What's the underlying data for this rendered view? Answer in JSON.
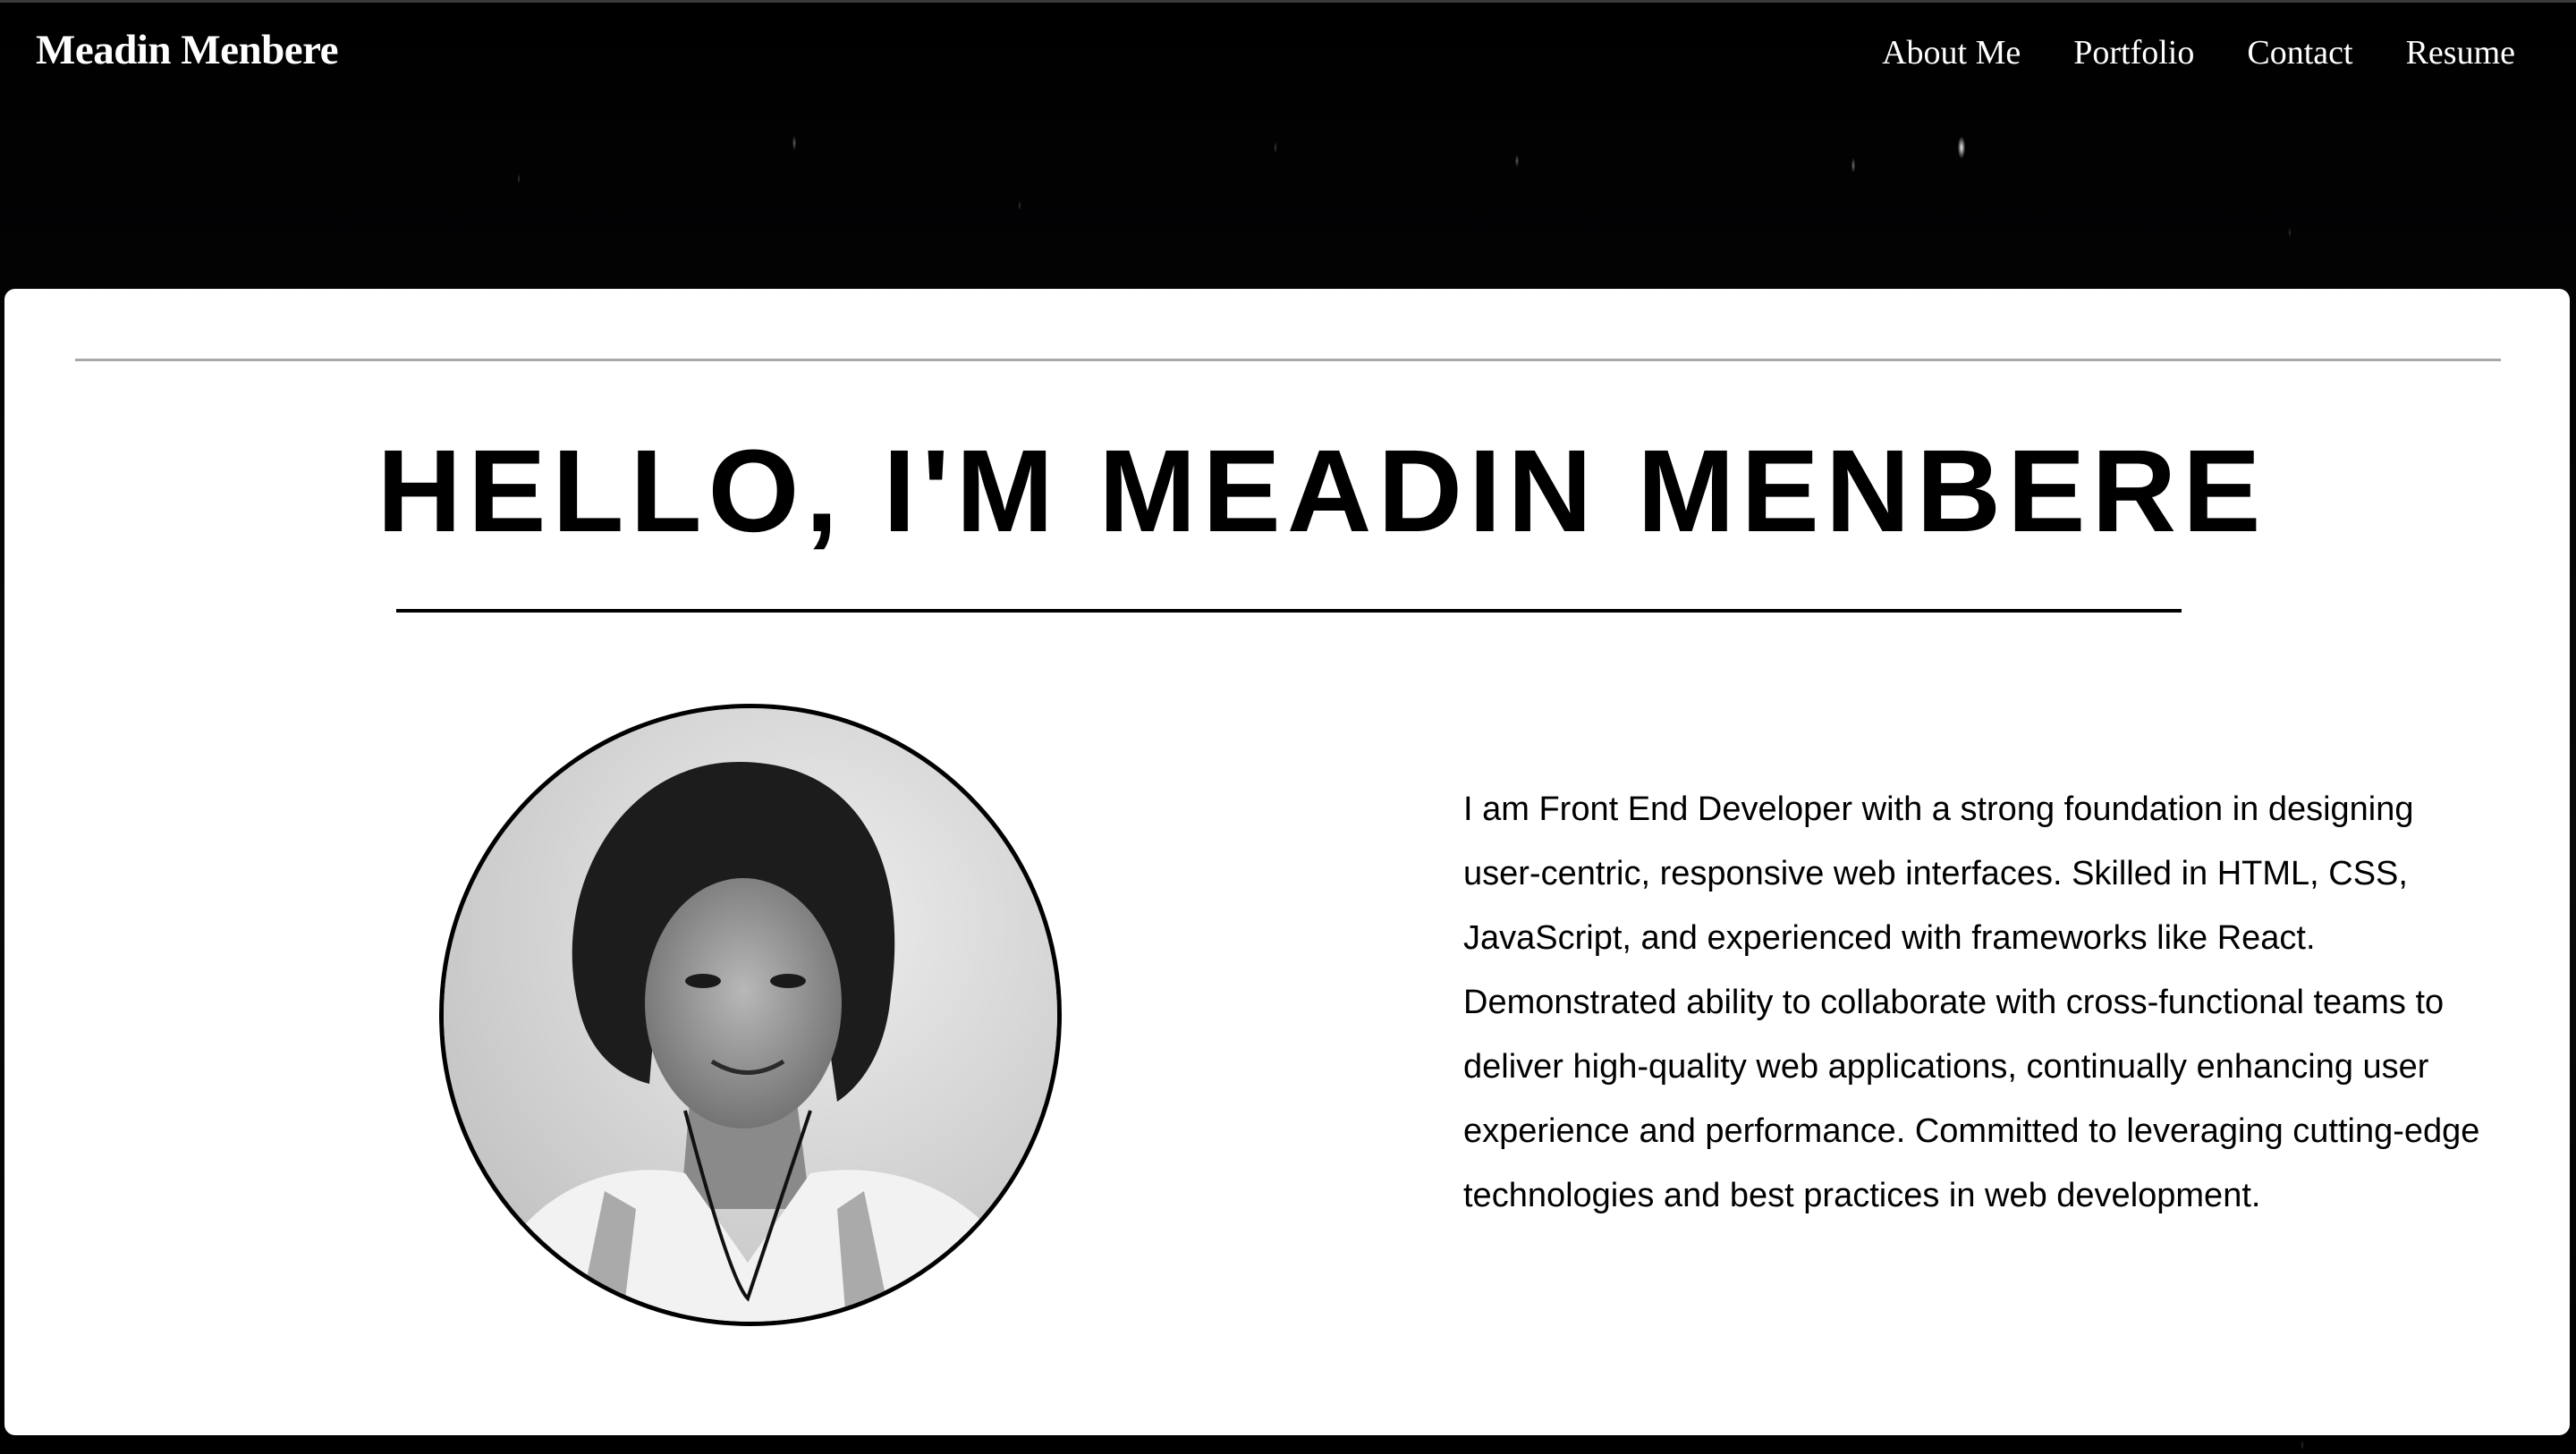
{
  "header": {
    "brand": "Meadin Menbere",
    "nav": [
      {
        "label": "About Me"
      },
      {
        "label": "Portfolio"
      },
      {
        "label": "Contact"
      },
      {
        "label": "Resume"
      }
    ]
  },
  "main": {
    "heading": "HELLO, I'M MEADIN MENBERE",
    "bio": "I am Front End Developer with a strong foundation in designing user-centric, responsive web interfaces. Skilled in HTML, CSS, JavaScript, and experienced with frameworks like React. Demonstrated ability to collaborate with cross-functional teams to deliver high-quality web applications, continually enhancing user experience and performance. Committed to leveraging cutting-edge technologies and best practices in web development."
  },
  "colors": {
    "header_background": "#000000",
    "card_background": "#ffffff",
    "text": "#000000",
    "nav_text": "#ffffff"
  }
}
